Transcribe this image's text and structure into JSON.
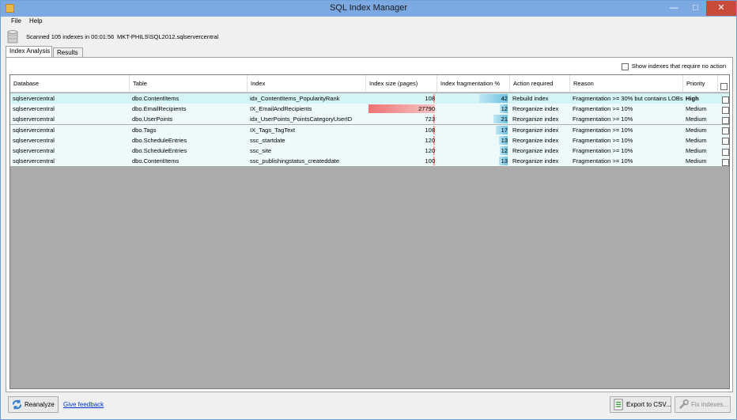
{
  "window": {
    "title": "SQL Index Manager",
    "minimize_glyph": "—",
    "maximize_glyph": "□",
    "close_glyph": "✕"
  },
  "menu": {
    "file": "File",
    "help": "Help"
  },
  "status": {
    "scan_text": "Scanned 105 indexes in 00:01:56",
    "server": "MKT-PHILS\\SQL2012.sqlservercentral"
  },
  "tabs": {
    "analysis": "Index Analysis",
    "results": "Results"
  },
  "options": {
    "show_no_action": "Show indexes that require no action"
  },
  "columns": {
    "database": "Database",
    "table": "Table",
    "index": "Index",
    "size": "Index size (pages)",
    "fragmentation": "Index fragmentation %",
    "action": "Action required",
    "reason": "Reason",
    "priority": "Priority"
  },
  "rows": [
    {
      "database": "sqlservercentral",
      "table": "dbo.ContentItems",
      "index": "idx_ContentItems_PopularityRank",
      "size": "108",
      "size_value": 108,
      "frag": "42",
      "frag_value": 42,
      "action": "Rebuild index",
      "reason": "Fragmentation >= 30% but contains LOBs",
      "priority": "High"
    },
    {
      "database": "sqlservercentral",
      "table": "dbo.EmailRecipients",
      "index": "IX_EmailAndRecipients",
      "size": "27790",
      "size_value": 27790,
      "frag": "12",
      "frag_value": 12,
      "action": "Reorganize index",
      "reason": "Fragmentation >= 10%",
      "priority": "Medium"
    },
    {
      "database": "sqlservercentral",
      "table": "dbo.UserPoints",
      "index": "idx_UserPoints_PointsCategoryUserID",
      "size": "723",
      "size_value": 723,
      "frag": "21",
      "frag_value": 21,
      "action": "Reorganize index",
      "reason": "Fragmentation >= 10%",
      "priority": "Medium"
    },
    {
      "database": "sqlservercentral",
      "table": "dbo.Tags",
      "index": "IX_Tags_TagText",
      "size": "108",
      "size_value": 108,
      "frag": "17",
      "frag_value": 17,
      "action": "Reorganize index",
      "reason": "Fragmentation >= 10%",
      "priority": "Medium"
    },
    {
      "database": "sqlservercentral",
      "table": "dbo.ScheduleEntries",
      "index": "ssc_startdate",
      "size": "120",
      "size_value": 120,
      "frag": "13",
      "frag_value": 13,
      "action": "Reorganize index",
      "reason": "Fragmentation >= 10%",
      "priority": "Medium"
    },
    {
      "database": "sqlservercentral",
      "table": "dbo.ScheduleEntries",
      "index": "ssc_site",
      "size": "120",
      "size_value": 120,
      "frag": "12",
      "frag_value": 12,
      "action": "Reorganize index",
      "reason": "Fragmentation >= 10%",
      "priority": "Medium"
    },
    {
      "database": "sqlservercentral",
      "table": "dbo.ContentItems",
      "index": "ssc_publishingstatus_createddate",
      "size": "100",
      "size_value": 100,
      "frag": "13",
      "frag_value": 13,
      "action": "Reorganize index",
      "reason": "Fragmentation >= 10%",
      "priority": "Medium"
    }
  ],
  "footer": {
    "reanalyze": "Reanalyze",
    "feedback": "Give feedback",
    "export": "Export to CSV...",
    "fix": "Fix indexes..."
  },
  "icons": {
    "app": "app-icon",
    "database": "database-icon",
    "reanalyze": "refresh-icon",
    "export": "csv-export-icon",
    "fix": "wrench-icon"
  },
  "colors": {
    "titlebar": "#7ca9e2",
    "size_bar": "#ee7373",
    "frag_bar": "#6dc1e0",
    "row_selected": "#d4f4f6",
    "row": "#eefafa",
    "link": "#0033cc"
  }
}
